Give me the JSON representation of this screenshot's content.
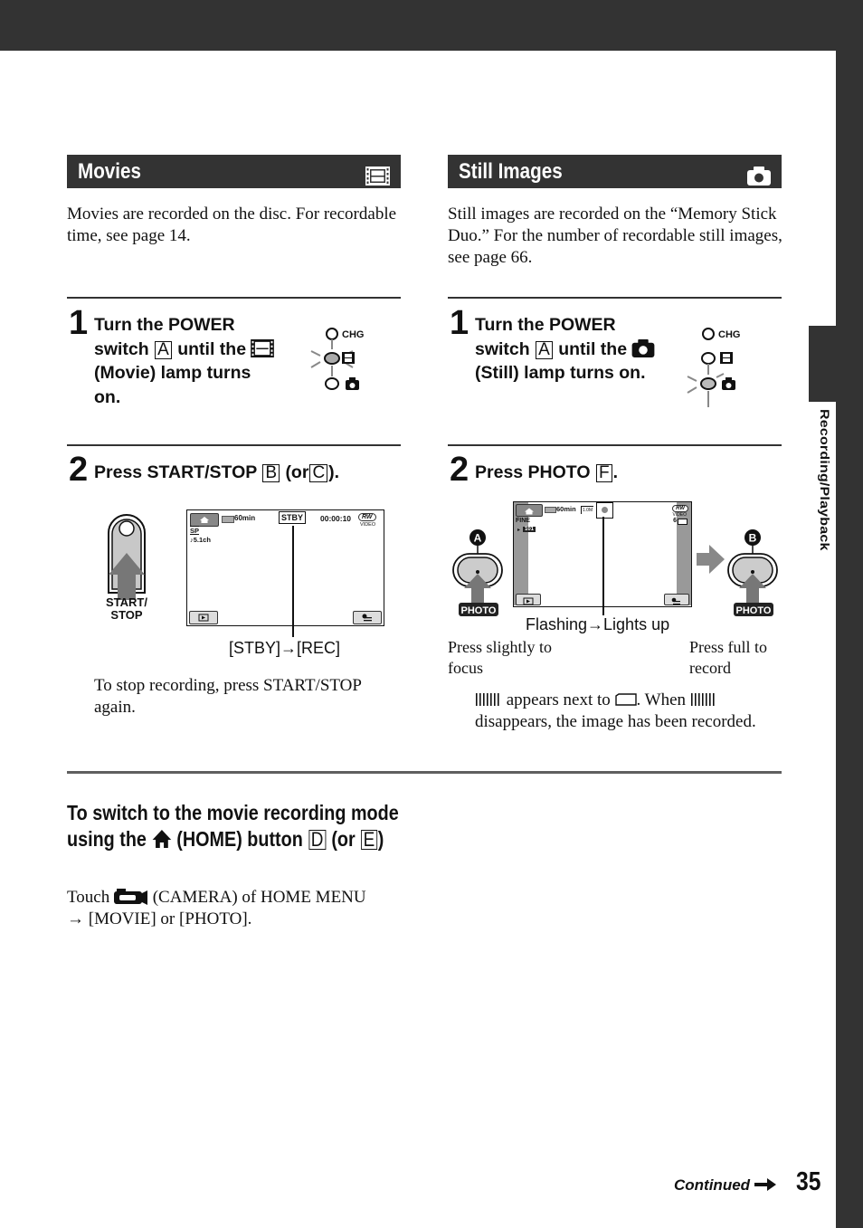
{
  "side_tab": {
    "label": "Recording/Playback"
  },
  "movies": {
    "title": "Movies",
    "title_icon": "film-strip-icon",
    "intro": "Movies are recorded on the disc. For recordable time, see page 14.",
    "step1": {
      "number": "1",
      "text_a": "Turn the POWER switch",
      "box": "A",
      "text_b": "until the",
      "icon": "film-strip-icon",
      "text_c": "(Movie) lamp turns on.",
      "lamp_labels": [
        "CHG"
      ]
    },
    "step2": {
      "number": "2",
      "text_a": "Press START/STOP",
      "box1": "B",
      "text_b": "(or",
      "box2": "C",
      "text_c": ")."
    },
    "button_label_line1": "START/",
    "button_label_line2": "STOP",
    "lcd": {
      "battery": "60min",
      "status": "STBY",
      "counter": "00:00:10",
      "disc": "RW",
      "disc_sub": "VIDEO",
      "quality": "SP",
      "audio": "♪5.1ch"
    },
    "callout": "[STBY]→[REC]",
    "note": "To stop recording, press START/STOP again."
  },
  "still": {
    "title": "Still Images",
    "title_icon": "camera-icon",
    "intro": "Still images are recorded on the “Memory Stick Duo.” For the number of recordable still images, see page 66.",
    "step1": {
      "number": "1",
      "text_a": "Turn the POWER switch",
      "box": "A",
      "text_b": "until the",
      "icon": "camera-icon",
      "text_c": "(Still) lamp turns on.",
      "lamp_labels": [
        "CHG"
      ]
    },
    "step2": {
      "number": "2",
      "text_a": "Press PHOTO",
      "box": "F",
      "text_b": "."
    },
    "lcd": {
      "battery": "60min",
      "size": "1.0M",
      "quality": "FINE",
      "folder": "101",
      "disc": "RW",
      "disc_sub": "VIDEO",
      "remaining": "6"
    },
    "badge_a": "A",
    "badge_b": "B",
    "photo_label": "PHOTO",
    "callout": "Flashing→Lights up",
    "caption_left": "Press slightly to focus",
    "caption_right": "Press full to record",
    "note_a": "appears next to",
    "note_b": ". When",
    "note_c": "disappears, the image has been recorded."
  },
  "switch_mode": {
    "heading_a": "To switch to the movie recording mode using the",
    "heading_icon": "home-icon",
    "heading_b": "(HOME) button",
    "box1": "D",
    "heading_c": "(or",
    "box2": "E",
    "heading_d": ")",
    "body_a": "Touch",
    "body_icon": "camera-body-icon",
    "body_b": "(CAMERA) of HOME MENU",
    "body_c": "→ [MOVIE] or [PHOTO]."
  },
  "footer": {
    "continued": "Continued",
    "arrow": "➞",
    "page": "35"
  }
}
